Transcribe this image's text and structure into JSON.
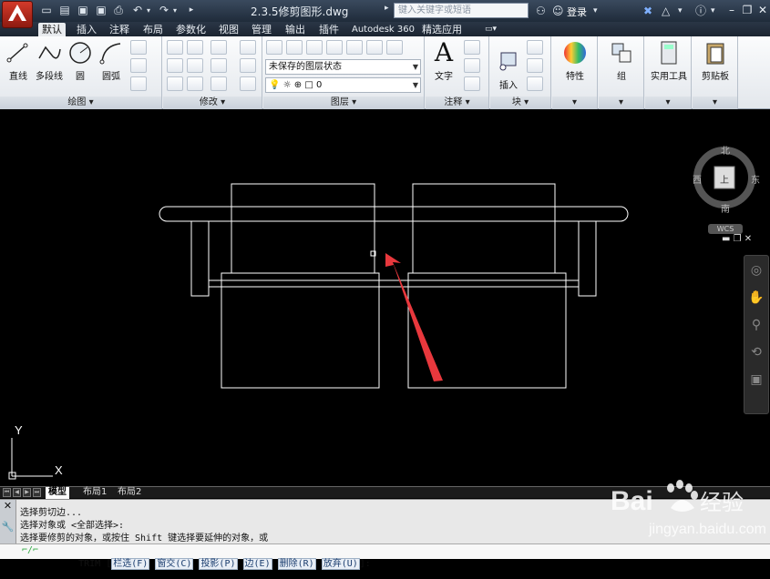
{
  "titlebar": {
    "doc_title": "2.3.5修剪图形.dwg",
    "search_placeholder": "键入关键字或短语",
    "login": "登录"
  },
  "tabs": [
    {
      "label": "默认",
      "active": true
    },
    {
      "label": "插入"
    },
    {
      "label": "注释"
    },
    {
      "label": "布局"
    },
    {
      "label": "参数化"
    },
    {
      "label": "视图"
    },
    {
      "label": "管理"
    },
    {
      "label": "输出"
    },
    {
      "label": "插件"
    },
    {
      "label": "Autodesk 360"
    },
    {
      "label": "精选应用"
    }
  ],
  "ribbon": {
    "draw": {
      "title": "绘图",
      "line": "直线",
      "polyline": "多段线",
      "circle": "圆",
      "arc": "圆弧"
    },
    "modify": {
      "title": "修改"
    },
    "layers": {
      "title": "图层",
      "state": "未保存的图层状态",
      "current": "0"
    },
    "annotation": {
      "title": "注释",
      "text": "文字"
    },
    "block": {
      "title": "块",
      "insert": "插入"
    },
    "properties": {
      "label": "特性"
    },
    "groups": {
      "label": "组"
    },
    "utilities": {
      "label": "实用工具"
    },
    "clipboard": {
      "label": "剪贴板"
    }
  },
  "viewcube": {
    "north": "北",
    "south": "南",
    "east": "东",
    "west": "西",
    "face": "上",
    "wcs": "WCS"
  },
  "ucs": {
    "x": "X",
    "y": "Y"
  },
  "layout_tabs": [
    "模型",
    "布局1",
    "布局2"
  ],
  "command": {
    "history": [
      "选择剪切边...",
      "选择对象或 <全部选择>:",
      "选择要修剪的对象，或按住 Shift 键选择要延伸的对象，或"
    ],
    "prompt_prefix": "TRIM [",
    "options": [
      "栏选(F)",
      "窗交(C)",
      "投影(P)",
      "边(E)",
      "删除(R)",
      "放弃(U)"
    ],
    "prompt_suffix": "]:"
  },
  "watermark": {
    "brand": "Bai",
    "sub": "经验",
    "url": "jingyan.baidu.com"
  },
  "colors": {
    "accent_arrow": "#e8383d",
    "title_bg": "#2b3748",
    "canvas": "#000000",
    "lines": "#ffffff"
  }
}
